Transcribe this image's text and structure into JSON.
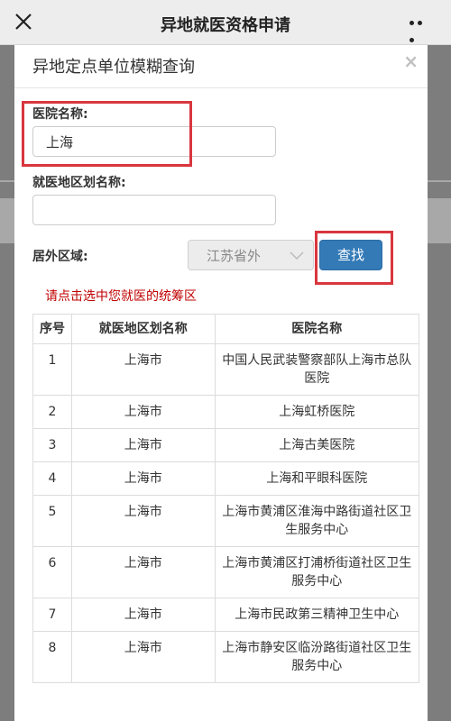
{
  "header": {
    "title": "异地就医资格申请"
  },
  "dialog": {
    "title": "异地定点单位模糊查询",
    "close_glyph": "×",
    "hospital_label": "医院名称:",
    "hospital_value": "上海",
    "region_label": "就医地区划名称:",
    "region_value": "",
    "area_label": "居外区域:",
    "area_selected": "江苏省外",
    "search_label": "查找",
    "hint": "请点击选中您就医的统筹区"
  },
  "table": {
    "headers": [
      "序号",
      "就医地区划名称",
      "医院名称"
    ],
    "rows": [
      {
        "no": "1",
        "region": "上海市",
        "hospital": "中国人民武装警察部队上海市总队医院"
      },
      {
        "no": "2",
        "region": "上海市",
        "hospital": "上海虹桥医院"
      },
      {
        "no": "3",
        "region": "上海市",
        "hospital": "上海古美医院"
      },
      {
        "no": "4",
        "region": "上海市",
        "hospital": "上海和平眼科医院"
      },
      {
        "no": "5",
        "region": "上海市",
        "hospital": "上海市黄浦区淮海中路街道社区卫生服务中心"
      },
      {
        "no": "6",
        "region": "上海市",
        "hospital": "上海市黄浦区打浦桥街道社区卫生服务中心"
      },
      {
        "no": "7",
        "region": "上海市",
        "hospital": "上海市民政第三精神卫生中心"
      },
      {
        "no": "8",
        "region": "上海市",
        "hospital": "上海市静安区临汾路街道社区卫生服务中心"
      }
    ]
  },
  "colors": {
    "accent": "#337ab7",
    "hint": "#c00000",
    "annotation": "#d9363e"
  }
}
